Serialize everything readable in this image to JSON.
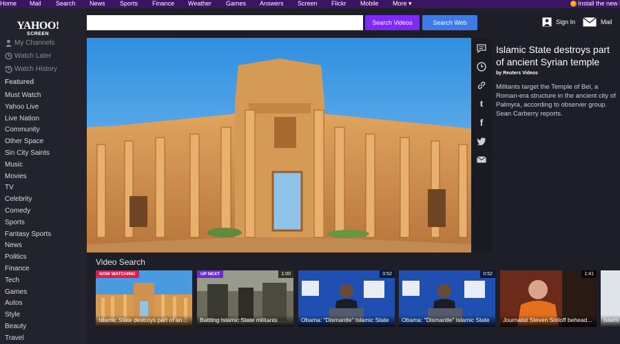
{
  "topnav": {
    "items": [
      "Home",
      "Mail",
      "Search",
      "News",
      "Sports",
      "Finance",
      "Weather",
      "Games",
      "Answers",
      "Screen",
      "Flickr",
      "Mobile",
      "More"
    ],
    "install": "Install the new F"
  },
  "logo": {
    "line1": "YAHOO!",
    "line2": "SCREEN"
  },
  "sidebar": {
    "links": [
      {
        "label": "My Channels",
        "icon": "user-icon"
      },
      {
        "label": "Watch Later",
        "icon": "clock-icon"
      },
      {
        "label": "Watch History",
        "icon": "history-icon"
      }
    ],
    "featured_label": "Featured",
    "categories": [
      "Must Watch",
      "Yahoo Live",
      "Live Nation",
      "Community",
      "Other Space",
      "Sin City Saints",
      "Music",
      "Movies",
      "TV",
      "Celebrity",
      "Comedy",
      "Sports",
      "Fantasy Sports",
      "News",
      "Politics",
      "Finance",
      "Tech",
      "Games",
      "Autos",
      "Style",
      "Beauty",
      "Travel"
    ]
  },
  "search": {
    "placeholder": "",
    "value": "",
    "search_videos_label": "Search Videos",
    "search_web_label": "Search Web"
  },
  "header": {
    "sign_in": "Sign In",
    "mail": "Mail"
  },
  "video": {
    "title": "Islamic State destroys part of ancient Syrian temple",
    "byline": "by Reuters Videos",
    "description": "Militants target the Temple of Bel, a Roman-era structure in the ancient city of Palmyra, according to observer group. Sean Carberry reports."
  },
  "toolbar": {
    "icons": [
      "comment-icon",
      "clock-icon",
      "link-icon",
      "tumblr-icon",
      "facebook-icon",
      "twitter-icon",
      "email-icon"
    ]
  },
  "video_search": {
    "heading": "Video Search",
    "items": [
      {
        "caption": "Islamic State destroys part of an...",
        "badge": "NOW WATCHING",
        "badge_color": "#e6194b",
        "duration": ""
      },
      {
        "caption": "Battling Islamic State militants",
        "badge": "UP NEXT",
        "badge_color": "#6a2bd9",
        "duration": "1:00"
      },
      {
        "caption": "Obama: \"Dismantle\" Islamic State",
        "badge": "",
        "badge_color": "",
        "duration": "0:52"
      },
      {
        "caption": "Obama: \"Dismantle\" Islamic State",
        "badge": "",
        "badge_color": "",
        "duration": "0:52"
      },
      {
        "caption": "Journalist Steven Sotloff behead...",
        "badge": "",
        "badge_color": "",
        "duration": "1:41"
      },
      {
        "caption": "Islami",
        "badge": "",
        "badge_color": "",
        "duration": ""
      }
    ]
  },
  "colors": {
    "topnav_bg": "#3b1463",
    "search_videos_btn": "#7b2bf2",
    "search_web_btn": "#3f7ae6",
    "sidebar_bg": "#23232d"
  }
}
